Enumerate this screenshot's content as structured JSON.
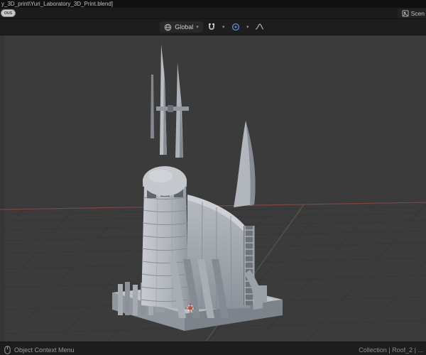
{
  "titlebar": {
    "title": "y_3D_print\\Yuri_Laboratory_3D_Print.blend]"
  },
  "topbar": {
    "back_button_label": "ous",
    "scene_label": "Scen"
  },
  "viewport_header": {
    "orientation_label": "Global",
    "caret": "▾"
  },
  "statusbar": {
    "left_label": "Object Context Menu",
    "right_label": "Collection | Roof_2 | ..."
  },
  "icons": {
    "orientation": "globe-icon",
    "snap": "magnet-icon",
    "proportional_editing": "blue-circle-icon",
    "falloff": "curve-icon",
    "statusbar_left": "mouse-icon",
    "scene": "scene-icon",
    "viewport_origin": "3d-cursor"
  },
  "colors": {
    "viewport_bg": "#3b3b3b",
    "panel_bg": "#1d1d1d",
    "accent_blue": "#5a86c8",
    "axis_red": "#8f4a4a",
    "axis_green": "#5f7d52",
    "model_light": "#c6cacf",
    "model_mid": "#9ea4ab",
    "model_dark": "#7d838b"
  }
}
